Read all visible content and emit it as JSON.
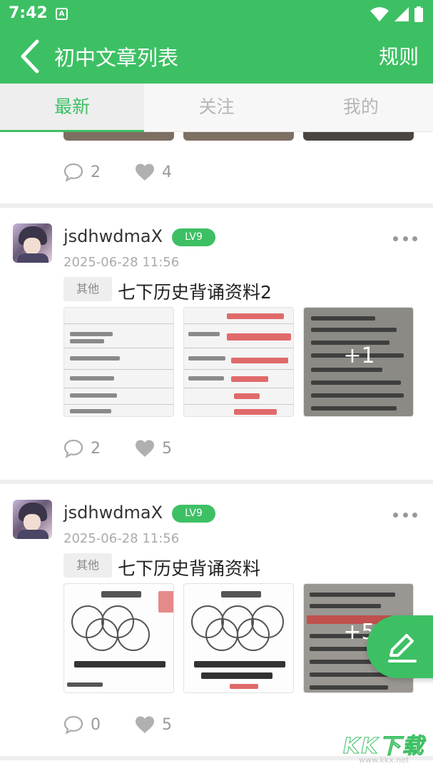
{
  "status_bar": {
    "time": "7:42",
    "notification_glyph": "A"
  },
  "app_bar": {
    "title": "初中文章列表",
    "right_action": "规则"
  },
  "tabs": [
    {
      "label": "最新",
      "active": true
    },
    {
      "label": "关注",
      "active": false
    },
    {
      "label": "我的",
      "active": false
    }
  ],
  "partial_card": {
    "comments": "2",
    "likes": "4"
  },
  "posts": [
    {
      "username": "jsdhwdmaX",
      "level": "LV9",
      "date": "2025-06-28 11:56",
      "tag": "其他",
      "title": "七下历史背诵资料2",
      "more_images_label": "+1",
      "comments": "2",
      "likes": "5"
    },
    {
      "username": "jsdhwdmaX",
      "level": "LV9",
      "date": "2025-06-28 11:56",
      "tag": "其他",
      "title": "七下历史背诵资料",
      "more_images_label": "+5",
      "comments": "0",
      "likes": "5"
    }
  ],
  "watermark": {
    "brand": "KK下载",
    "url": "www.kkx.net"
  },
  "colors": {
    "primary": "#3dc064",
    "tab_inactive": "#b6b6b6",
    "meta_text": "#999999"
  },
  "icons": [
    "back-arrow-icon",
    "comment-icon",
    "heart-icon",
    "more-dots-icon",
    "edit-pen-icon",
    "wifi-icon",
    "signal-icon",
    "battery-icon"
  ]
}
